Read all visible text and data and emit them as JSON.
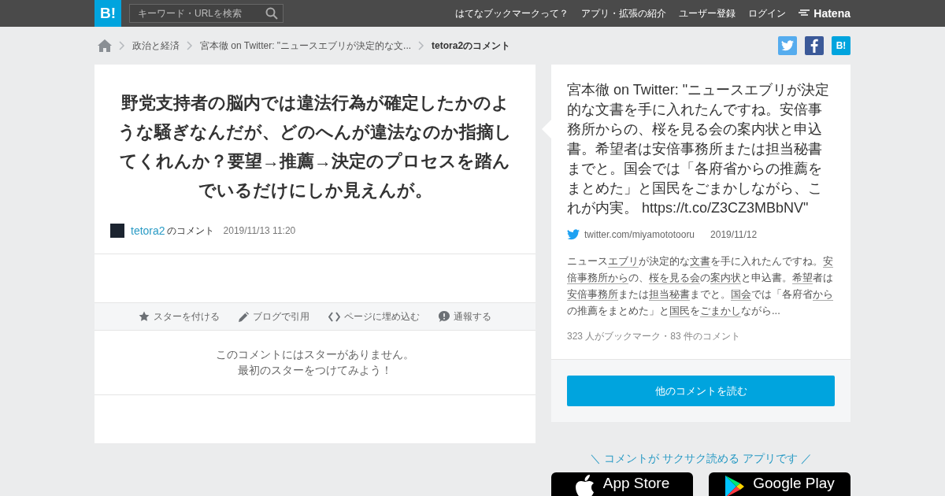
{
  "header": {
    "logo": "B!",
    "search": {
      "placeholder": "キーワード・URLを検索"
    },
    "nav": [
      "はてなブックマークって？",
      "アプリ・拡張の紹介",
      "ユーザー登録",
      "ログイン"
    ],
    "brand": "Hatena"
  },
  "breadcrumbs": [
    {
      "label": "政治と経済"
    },
    {
      "label": "宮本徹 on Twitter: \"ニュースエブリが決定的な文..."
    }
  ],
  "breadcrumb_current": "tetora2のコメント",
  "share": [
    {
      "kind": "twitter"
    },
    {
      "kind": "facebook"
    },
    {
      "kind": "hatena",
      "label": "B!"
    }
  ],
  "comment": {
    "text": "野党支持者の脳内では違法行為が確定したかのような騒ぎなんだが、どのへんが違法なのか指摘してくれんか？要望→推薦→決定のプロセスを踏んでいるだけにしか見えんが。",
    "user": "tetora2",
    "user_suffix": "のコメント",
    "time": "2019/11/13 11:20"
  },
  "actions": [
    {
      "kind": "star",
      "label": "スターを付ける"
    },
    {
      "kind": "pencil",
      "label": "ブログで引用"
    },
    {
      "kind": "code",
      "label": "ページに埋め込む"
    },
    {
      "kind": "report",
      "label": "通報する"
    }
  ],
  "stars_message": [
    "このコメントにはスターがありません。",
    "最初のスターをつけてみよう！"
  ],
  "entry": {
    "title": "宮本徹 on Twitter: \"ニュースエブリが決定的な文書を手に入れたんですね。安倍事務所からの、桜を見る会の案内状と申込書。希望者は安倍事務所または担当秘書までと。国会では「各府省からの推薦をまとめた」と国民をごまかしながら、これが内実。 https://t.co/Z3CZ3MBbNV\"",
    "domain": "twitter.com/miyamototooru",
    "date": "2019/11/12",
    "excerpt": [
      {
        "text": "ニュース",
        "link": false
      },
      {
        "text": "エブリ",
        "link": true
      },
      {
        "text": "が決定的な",
        "link": false
      },
      {
        "text": "文書",
        "link": true
      },
      {
        "text": "を手に入れたんですね。",
        "link": false
      },
      {
        "text": "安倍事務所から",
        "link": true
      },
      {
        "text": "の、",
        "link": false
      },
      {
        "text": "桜を見る会",
        "link": true
      },
      {
        "text": "の",
        "link": false
      },
      {
        "text": "案内状",
        "link": true
      },
      {
        "text": "と申込書。",
        "link": false
      },
      {
        "text": "希望",
        "link": true
      },
      {
        "text": "者は",
        "link": false
      },
      {
        "text": "安倍事務所",
        "link": true
      },
      {
        "text": "または",
        "link": false
      },
      {
        "text": "担当秘書",
        "link": true
      },
      {
        "text": "までと。",
        "link": false
      },
      {
        "text": "国会",
        "link": true
      },
      {
        "text": "では「各府省",
        "link": false
      },
      {
        "text": "から",
        "link": true
      },
      {
        "text": "の推薦をまとめた」と",
        "link": false
      },
      {
        "text": "国民",
        "link": true
      },
      {
        "text": "を",
        "link": false
      },
      {
        "text": "ごまかし",
        "link": true
      },
      {
        "text": "ながら...",
        "link": false
      }
    ],
    "stats": "323 人がブックマーク・83 件のコメント",
    "button": "他のコメントを読む"
  },
  "app_promo": {
    "tagline": "＼ コメントが サクサク読める アプリです ／",
    "stores": [
      {
        "kind": "apple",
        "label": "App Store"
      },
      {
        "kind": "google",
        "label": "Google Play"
      }
    ]
  }
}
